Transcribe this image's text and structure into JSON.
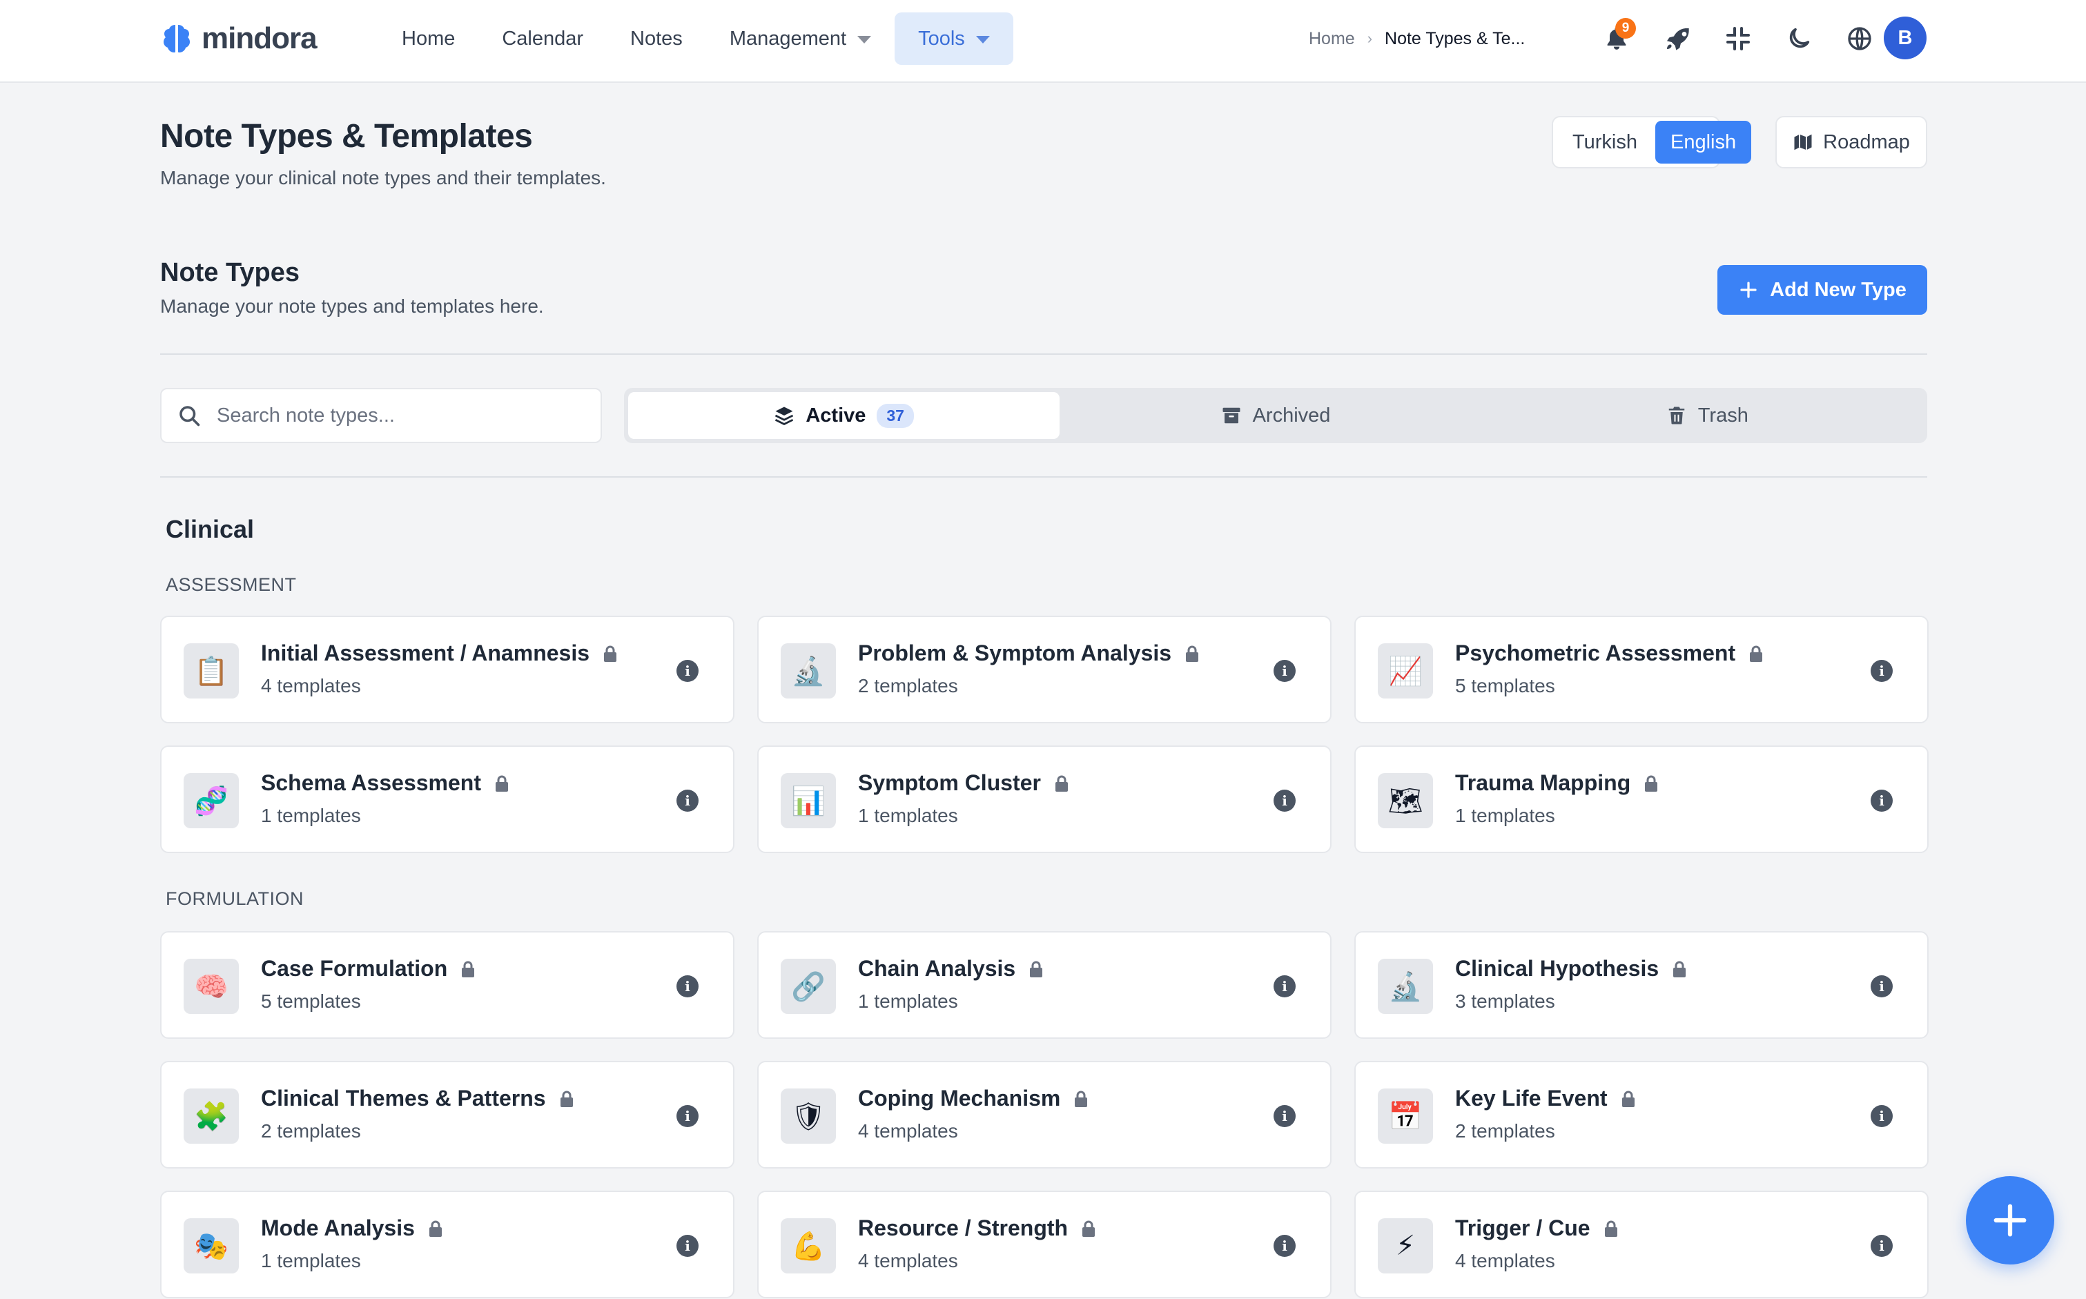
{
  "brand": {
    "name": "mindora",
    "accent": "#3b82f6"
  },
  "nav": {
    "items": [
      {
        "label": "Home",
        "active": false,
        "dropdown": false
      },
      {
        "label": "Calendar",
        "active": false,
        "dropdown": false
      },
      {
        "label": "Notes",
        "active": false,
        "dropdown": false
      },
      {
        "label": "Management",
        "active": false,
        "dropdown": true
      },
      {
        "label": "Tools",
        "active": true,
        "dropdown": true
      }
    ]
  },
  "breadcrumb": {
    "home": "Home",
    "separator": "›",
    "current": "Note Types & Te..."
  },
  "topbar": {
    "notifications_count": "9",
    "icons": [
      "bell-icon",
      "rocket-icon",
      "compress-icon",
      "moon-icon",
      "globe-icon"
    ],
    "avatar_initial": "B"
  },
  "header": {
    "title": "Note Types & Templates",
    "subtitle": "Manage your clinical note types and their templates.",
    "languages": [
      "Turkish",
      "English"
    ],
    "active_language": "English",
    "roadmap_label": "Roadmap"
  },
  "section": {
    "title": "Note Types",
    "subtitle": "Manage your note types and templates here.",
    "add_button": "Add New Type"
  },
  "search": {
    "placeholder": "Search note types...",
    "value": ""
  },
  "tabs": [
    {
      "label": "Active",
      "count": "37",
      "active": true,
      "icon": "layers-icon"
    },
    {
      "label": "Archived",
      "count": null,
      "active": false,
      "icon": "archive-icon"
    },
    {
      "label": "Trash",
      "count": null,
      "active": false,
      "icon": "trash-icon"
    }
  ],
  "groups": [
    {
      "title": "Clinical",
      "subgroups": [
        {
          "title": "ASSESSMENT",
          "cards": [
            {
              "icon": "📋",
              "title": "Initial Assessment / Anamnesis",
              "count": "4 templates",
              "locked": true
            },
            {
              "icon": "🔬",
              "title": "Problem & Symptom Analysis",
              "count": "2 templates",
              "locked": true
            },
            {
              "icon": "📈",
              "title": "Psychometric Assessment",
              "count": "5 templates",
              "locked": true
            },
            {
              "icon": "🧬",
              "title": "Schema Assessment",
              "count": "1 templates",
              "locked": true
            },
            {
              "icon": "📊",
              "title": "Symptom Cluster",
              "count": "1 templates",
              "locked": true
            },
            {
              "icon": "🗺",
              "title": "Trauma Mapping",
              "count": "1 templates",
              "locked": true
            }
          ]
        },
        {
          "title": "FORMULATION",
          "cards": [
            {
              "icon": "🧠",
              "title": "Case Formulation",
              "count": "5 templates",
              "locked": true
            },
            {
              "icon": "🔗",
              "title": "Chain Analysis",
              "count": "1 templates",
              "locked": true
            },
            {
              "icon": "🔬",
              "title": "Clinical Hypothesis",
              "count": "3 templates",
              "locked": true
            },
            {
              "icon": "🧩",
              "title": "Clinical Themes & Patterns",
              "count": "2 templates",
              "locked": true
            },
            {
              "icon": "🛡",
              "title": "Coping Mechanism",
              "count": "4 templates",
              "locked": true
            },
            {
              "icon": "📅",
              "title": "Key Life Event",
              "count": "2 templates",
              "locked": true
            },
            {
              "icon": "🎭",
              "title": "Mode Analysis",
              "count": "1 templates",
              "locked": true
            },
            {
              "icon": "💪",
              "title": "Resource / Strength",
              "count": "4 templates",
              "locked": true
            },
            {
              "icon": "⚡",
              "title": "Trigger / Cue",
              "count": "4 templates",
              "locked": true
            }
          ]
        }
      ]
    }
  ]
}
